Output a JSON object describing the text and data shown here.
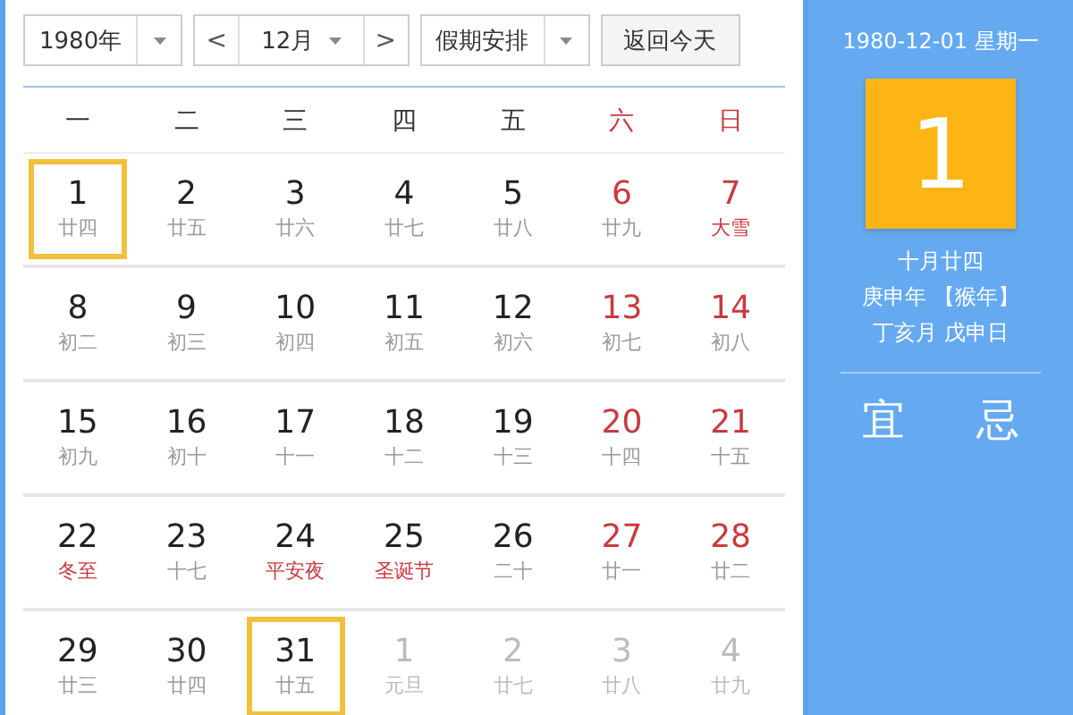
{
  "toolbar": {
    "year": "1980年",
    "month": "12月",
    "prev": "<",
    "next": ">",
    "holiday": "假期安排",
    "today_button": "返回今天"
  },
  "weekdays": [
    {
      "label": "一",
      "weekend": false
    },
    {
      "label": "二",
      "weekend": false
    },
    {
      "label": "三",
      "weekend": false
    },
    {
      "label": "四",
      "weekend": false
    },
    {
      "label": "五",
      "weekend": false
    },
    {
      "label": "六",
      "weekend": true
    },
    {
      "label": "日",
      "weekend": true
    }
  ],
  "weeks": [
    [
      {
        "day": "1",
        "lunar": "廿四",
        "weekend": false,
        "other_month": false,
        "festival": false,
        "outlined": true
      },
      {
        "day": "2",
        "lunar": "廿五",
        "weekend": false,
        "other_month": false,
        "festival": false,
        "outlined": false
      },
      {
        "day": "3",
        "lunar": "廿六",
        "weekend": false,
        "other_month": false,
        "festival": false,
        "outlined": false
      },
      {
        "day": "4",
        "lunar": "廿七",
        "weekend": false,
        "other_month": false,
        "festival": false,
        "outlined": false
      },
      {
        "day": "5",
        "lunar": "廿八",
        "weekend": false,
        "other_month": false,
        "festival": false,
        "outlined": false
      },
      {
        "day": "6",
        "lunar": "廿九",
        "weekend": true,
        "other_month": false,
        "festival": false,
        "outlined": false
      },
      {
        "day": "7",
        "lunar": "大雪",
        "weekend": true,
        "other_month": false,
        "festival": true,
        "outlined": false
      }
    ],
    [
      {
        "day": "8",
        "lunar": "初二",
        "weekend": false,
        "other_month": false,
        "festival": false,
        "outlined": false
      },
      {
        "day": "9",
        "lunar": "初三",
        "weekend": false,
        "other_month": false,
        "festival": false,
        "outlined": false
      },
      {
        "day": "10",
        "lunar": "初四",
        "weekend": false,
        "other_month": false,
        "festival": false,
        "outlined": false
      },
      {
        "day": "11",
        "lunar": "初五",
        "weekend": false,
        "other_month": false,
        "festival": false,
        "outlined": false
      },
      {
        "day": "12",
        "lunar": "初六",
        "weekend": false,
        "other_month": false,
        "festival": false,
        "outlined": false
      },
      {
        "day": "13",
        "lunar": "初七",
        "weekend": true,
        "other_month": false,
        "festival": false,
        "outlined": false
      },
      {
        "day": "14",
        "lunar": "初八",
        "weekend": true,
        "other_month": false,
        "festival": false,
        "outlined": false
      }
    ],
    [
      {
        "day": "15",
        "lunar": "初九",
        "weekend": false,
        "other_month": false,
        "festival": false,
        "outlined": false
      },
      {
        "day": "16",
        "lunar": "初十",
        "weekend": false,
        "other_month": false,
        "festival": false,
        "outlined": false
      },
      {
        "day": "17",
        "lunar": "十一",
        "weekend": false,
        "other_month": false,
        "festival": false,
        "outlined": false
      },
      {
        "day": "18",
        "lunar": "十二",
        "weekend": false,
        "other_month": false,
        "festival": false,
        "outlined": false
      },
      {
        "day": "19",
        "lunar": "十三",
        "weekend": false,
        "other_month": false,
        "festival": false,
        "outlined": false
      },
      {
        "day": "20",
        "lunar": "十四",
        "weekend": true,
        "other_month": false,
        "festival": false,
        "outlined": false
      },
      {
        "day": "21",
        "lunar": "十五",
        "weekend": true,
        "other_month": false,
        "festival": false,
        "outlined": false
      }
    ],
    [
      {
        "day": "22",
        "lunar": "冬至",
        "weekend": false,
        "other_month": false,
        "festival": true,
        "outlined": false
      },
      {
        "day": "23",
        "lunar": "十七",
        "weekend": false,
        "other_month": false,
        "festival": false,
        "outlined": false
      },
      {
        "day": "24",
        "lunar": "平安夜",
        "weekend": false,
        "other_month": false,
        "festival": true,
        "outlined": false
      },
      {
        "day": "25",
        "lunar": "圣诞节",
        "weekend": false,
        "other_month": false,
        "festival": true,
        "outlined": false
      },
      {
        "day": "26",
        "lunar": "二十",
        "weekend": false,
        "other_month": false,
        "festival": false,
        "outlined": false
      },
      {
        "day": "27",
        "lunar": "廿一",
        "weekend": true,
        "other_month": false,
        "festival": false,
        "outlined": false
      },
      {
        "day": "28",
        "lunar": "廿二",
        "weekend": true,
        "other_month": false,
        "festival": false,
        "outlined": false
      }
    ],
    [
      {
        "day": "29",
        "lunar": "廿三",
        "weekend": false,
        "other_month": false,
        "festival": false,
        "outlined": false
      },
      {
        "day": "30",
        "lunar": "廿四",
        "weekend": false,
        "other_month": false,
        "festival": false,
        "outlined": false
      },
      {
        "day": "31",
        "lunar": "廿五",
        "weekend": false,
        "other_month": false,
        "festival": false,
        "outlined": true
      },
      {
        "day": "1",
        "lunar": "元旦",
        "other_month": true,
        "festival": false,
        "outlined": false
      },
      {
        "day": "2",
        "lunar": "廿七",
        "other_month": true,
        "festival": false,
        "outlined": false
      },
      {
        "day": "3",
        "lunar": "廿八",
        "other_month": true,
        "festival": false,
        "outlined": false
      },
      {
        "day": "4",
        "lunar": "廿九",
        "other_month": true,
        "festival": false,
        "outlined": false
      }
    ]
  ],
  "detail": {
    "date": "1980-12-01 星期一",
    "big_day": "1",
    "lunar_date": "十月廿四",
    "year_line": "庚申年 【猴年】",
    "month_line": "丁亥月 戊申日",
    "good": "宜",
    "bad": "忌"
  }
}
